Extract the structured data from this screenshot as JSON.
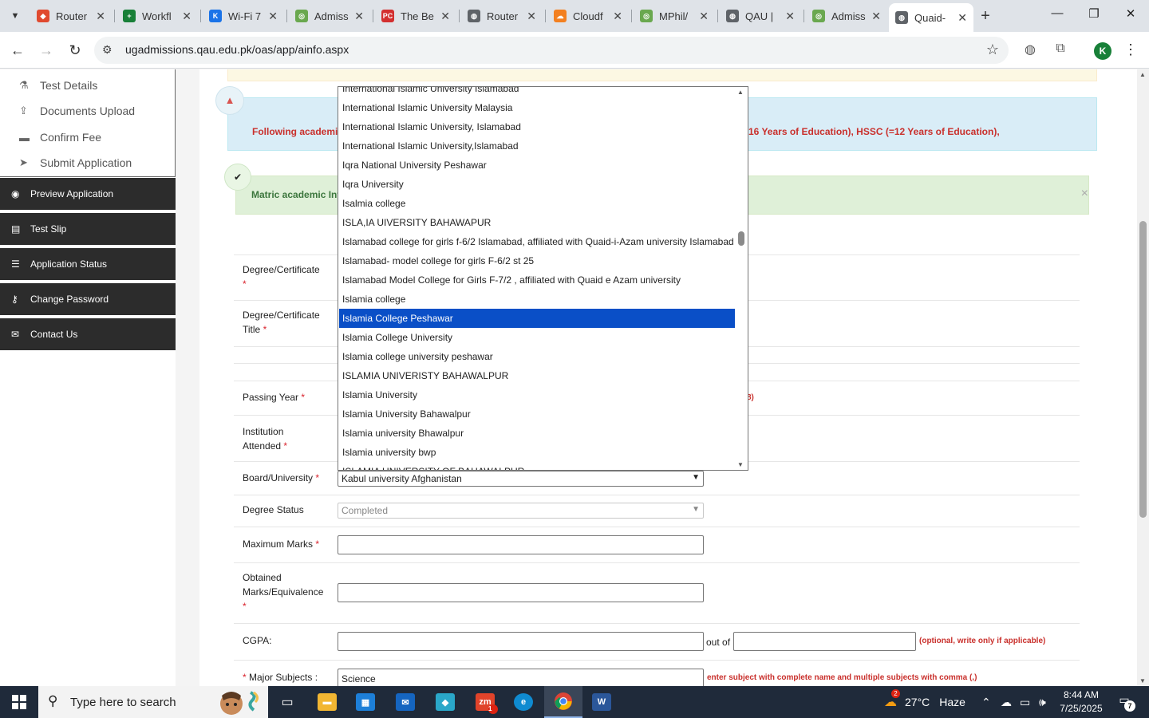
{
  "browser": {
    "tabs": [
      {
        "title": "Router",
        "fav_color": "#e04a2f",
        "fav_glyph": "◆",
        "icon": "router-icon"
      },
      {
        "title": "Workfl",
        "fav_color": "#188038",
        "fav_glyph": "+",
        "icon": "sheets-icon"
      },
      {
        "title": "Wi-Fi 7",
        "fav_color": "#1a73e8",
        "fav_glyph": "K",
        "icon": "k-site-icon"
      },
      {
        "title": "Admiss",
        "fav_color": "#6aa84f",
        "fav_glyph": "◎",
        "icon": "university-seal-icon"
      },
      {
        "title": "The Be",
        "fav_color": "#d32f2f",
        "fav_glyph": "PC",
        "icon": "pc-site-icon"
      },
      {
        "title": "Router",
        "fav_color": "#5f6368",
        "fav_glyph": "◍",
        "icon": "globe-icon"
      },
      {
        "title": "Cloudf",
        "fav_color": "#f38020",
        "fav_glyph": "☁",
        "icon": "cloudflare-icon"
      },
      {
        "title": "MPhil/",
        "fav_color": "#6aa84f",
        "fav_glyph": "◎",
        "icon": "university-seal-icon"
      },
      {
        "title": "QAU |",
        "fav_color": "#5f6368",
        "fav_glyph": "◍",
        "icon": "globe-icon"
      },
      {
        "title": "Admiss",
        "fav_color": "#6aa84f",
        "fav_glyph": "◎",
        "icon": "university-seal-icon"
      },
      {
        "title": "Quaid-",
        "fav_color": "#5f6368",
        "fav_glyph": "◍",
        "icon": "globe-icon",
        "active": true
      }
    ],
    "url": "ugadmissions.qau.edu.pk/oas/app/ainfo.aspx",
    "profile_initial": "K"
  },
  "sidebar": {
    "sub_items": [
      {
        "label": "Test Details",
        "icon": "flask-icon",
        "glyph": "⚗"
      },
      {
        "label": "Documents Upload",
        "icon": "upload-icon",
        "glyph": "⇪"
      },
      {
        "label": "Confirm Fee",
        "icon": "credit-card-icon",
        "glyph": "▬"
      },
      {
        "label": "Submit Application",
        "icon": "send-icon",
        "glyph": "➤"
      }
    ],
    "nav_items": [
      {
        "label": "Preview Application",
        "icon": "eye-icon",
        "glyph": "◉"
      },
      {
        "label": "Test Slip",
        "icon": "id-card-icon",
        "glyph": "▤"
      },
      {
        "label": "Application Status",
        "icon": "list-icon",
        "glyph": "☰"
      },
      {
        "label": "Change Password",
        "icon": "key-icon",
        "glyph": "⚷"
      },
      {
        "label": "Contact Us",
        "icon": "envelope-icon",
        "glyph": "✉"
      }
    ]
  },
  "alerts": {
    "info_text_left": "Following academic",
    "info_text_right": "16 Years of Education), HSSC (=12 Years of Education),",
    "success_text": "Matric academic Info",
    "close": "×"
  },
  "form": {
    "degree_label": "Degree/Certificate",
    "degree_title_label": "Degree/Certificate Title",
    "passing_year_label": "Passing Year",
    "passing_year_hint": "8)",
    "institution_label": "Institution Attended",
    "board_label": "Board/University",
    "board_value": "Kabul university Afghanistan",
    "status_label": "Degree Status",
    "status_value": "Completed",
    "max_marks_label": "Maximum Marks",
    "obtained_label": "Obtained Marks/Equivalence",
    "cgpa_label": "CGPA:",
    "out_of": "out of",
    "cgpa_hint": "(optional, write only if applicable)",
    "major_label": "Major Subjects :",
    "major_value": "Science",
    "major_hint": "enter subject with complete name and multiple subjects with comma (,)",
    "required_mark": "*"
  },
  "dropdown": {
    "items": [
      "International Islamic University Islamabad",
      "International Islamic University Malaysia",
      "International Islamic University, Islamabad",
      "International Islamic University,Islamabad",
      "Iqra National University Peshawar",
      "Iqra University",
      "Isalmia college",
      "ISLA,IA UIVERSITY BAHAWAPUR",
      "Islamabad college for girls f-6/2 Islamabad, affiliated with Quaid-i-Azam university Islamabad",
      "Islamabad- model college for girls F-6/2 st 25",
      "Islamabad Model College for Girls F-7/2 , affiliated with Quaid e Azam university",
      "Islamia college",
      "Islamia College Peshawar",
      "Islamia College University",
      "Islamia college university peshawar",
      "ISLAMIA UNIVERISTY BAHAWALPUR",
      "Islamia University",
      "Islamia University Bahawalpur",
      "Islamia university Bhawalpur",
      "Islamia university bwp",
      "ISLAMIA UNIVERSITY OF BAHAWALPUR"
    ],
    "selected_index": 12,
    "selected_color": "#0a4fc7"
  },
  "taskbar": {
    "search_placeholder": "Type here to search",
    "weather_temp": "27°C",
    "weather_desc": "Haze",
    "time": "8:44 AM",
    "date": "7/25/2025",
    "notification_count": "7",
    "zoom_badge": "1",
    "weather_badge": "2"
  }
}
